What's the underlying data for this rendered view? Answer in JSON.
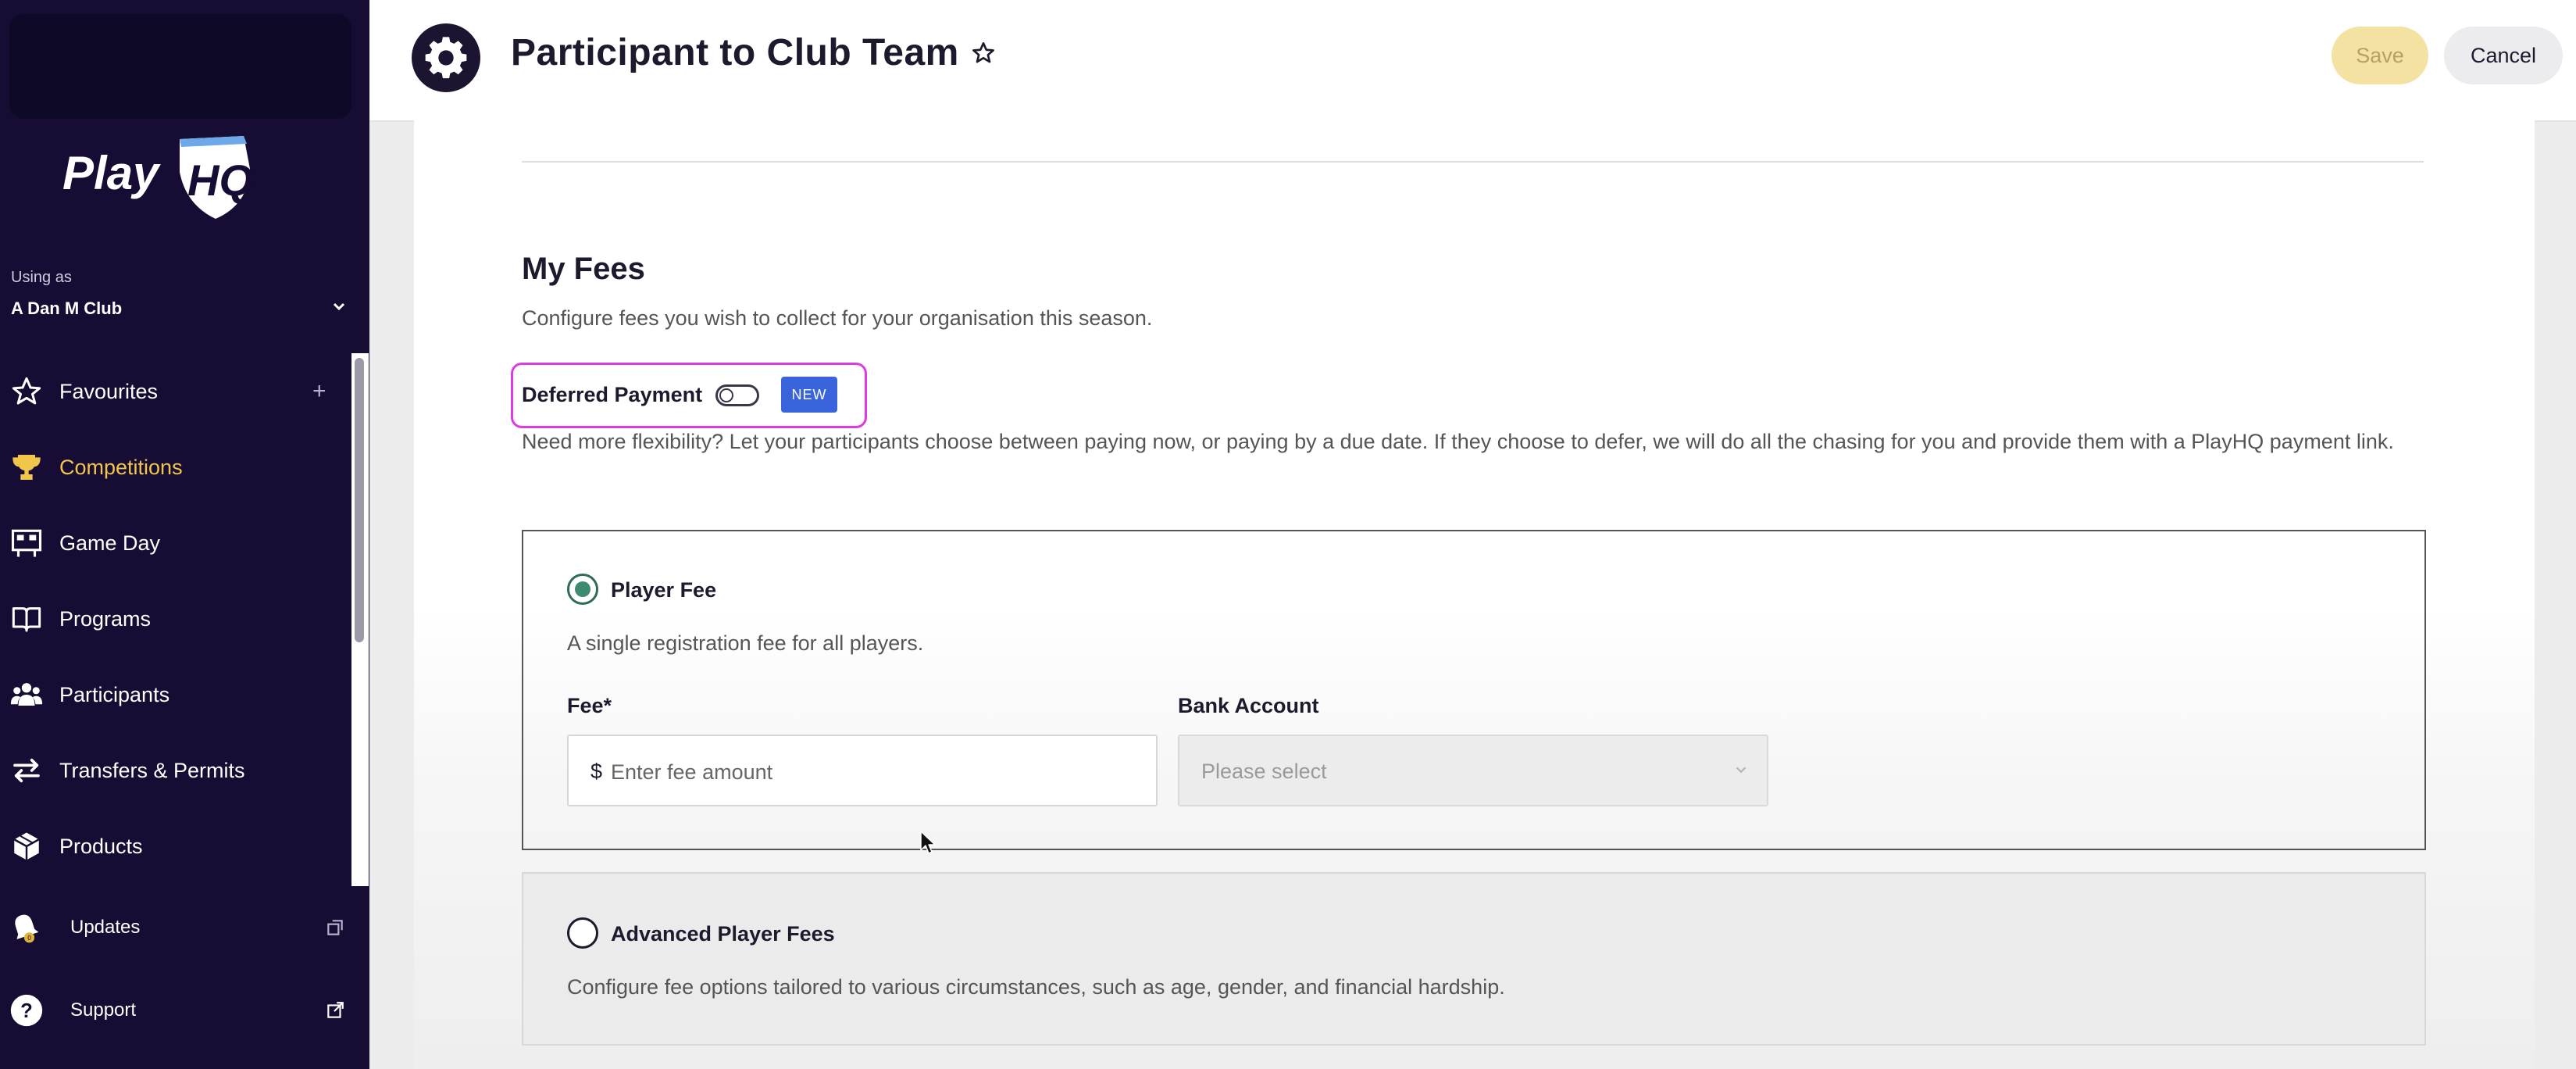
{
  "sidebar": {
    "logo_text": "PlayHQ",
    "using_as_label": "Using as",
    "org_name": "A Dan M Club",
    "items": [
      {
        "label": "Favourites",
        "icon": "star-icon",
        "action": "+"
      },
      {
        "label": "Competitions",
        "icon": "trophy-icon",
        "active": true
      },
      {
        "label": "Game Day",
        "icon": "scoreboard-icon"
      },
      {
        "label": "Programs",
        "icon": "book-icon"
      },
      {
        "label": "Participants",
        "icon": "people-icon"
      },
      {
        "label": "Transfers & Permits",
        "icon": "transfer-arrows-icon"
      },
      {
        "label": "Products",
        "icon": "box-icon"
      },
      {
        "label": "Updates",
        "icon": "bell-icon",
        "external": true,
        "badge": "0"
      },
      {
        "label": "Support",
        "icon": "help-icon",
        "external": true
      }
    ]
  },
  "header": {
    "title": "Participant to Club Team",
    "save_label": "Save",
    "cancel_label": "Cancel"
  },
  "fees": {
    "title": "My Fees",
    "description": "Configure fees you wish to collect for your organisation this season.",
    "deferred_label": "Deferred Payment",
    "deferred_enabled": false,
    "new_badge": "NEW",
    "deferred_description": "Need more flexibility? Let your participants choose between paying now, or paying by a due date. If they choose to defer, we will do all the chasing for you and provide them with a PlayHQ payment link.",
    "player_fee": {
      "title": "Player Fee",
      "selected": true,
      "description": "A single registration fee for all players.",
      "fee_label": "Fee*",
      "currency": "$",
      "fee_placeholder": "Enter fee amount",
      "bank_label": "Bank Account",
      "bank_placeholder": "Please select"
    },
    "advanced": {
      "title": "Advanced Player Fees",
      "selected": false,
      "description": "Configure fee options tailored to various circumstances, such as age, gender, and financial hardship."
    }
  },
  "colors": {
    "sidebar_bg": "#160c34",
    "active_nav": "#f2c54b",
    "highlight": "#e03ae6",
    "badge_blue": "#3a64dc",
    "radio_green": "#3e8a6e"
  }
}
